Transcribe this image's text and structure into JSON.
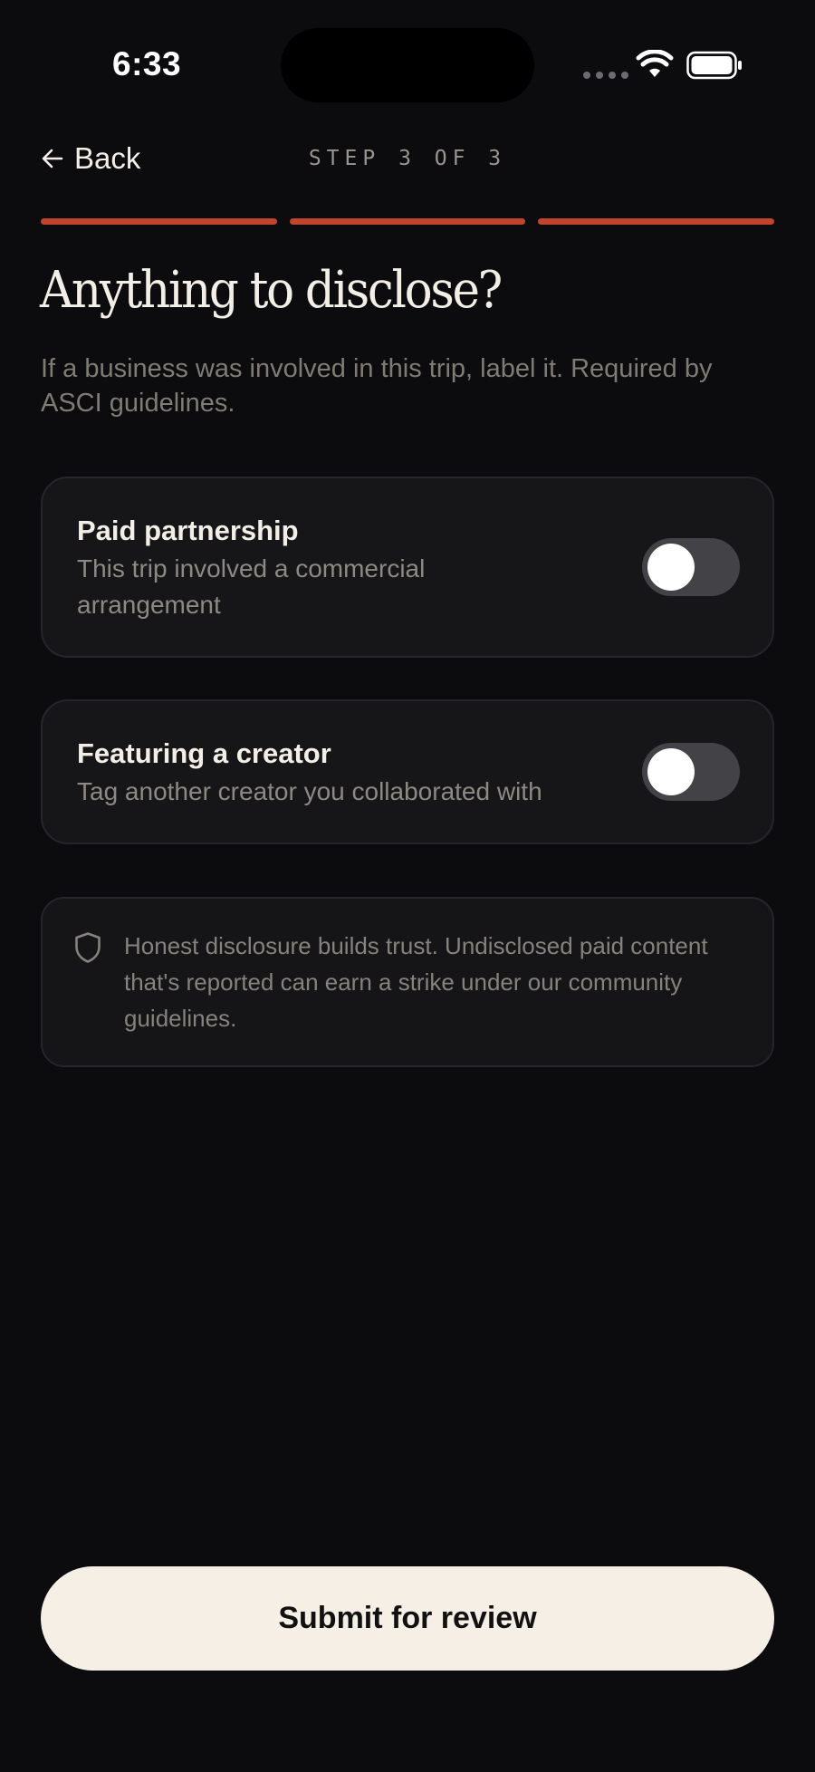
{
  "status_bar": {
    "time": "6:33",
    "icons": [
      "signal-dots-icon",
      "wifi-icon",
      "battery-icon"
    ]
  },
  "header": {
    "back_label": "Back",
    "step_label": "STEP 3 OF 3"
  },
  "progress": {
    "total_steps": 3,
    "current_step": 3
  },
  "main": {
    "title": "Anything to disclose?",
    "subtitle": "If a business was involved in this trip, label it. Required by ASCI guidelines.",
    "options": [
      {
        "title": "Paid partnership",
        "description": "This trip involved a commercial arrangement",
        "enabled": false
      },
      {
        "title": "Featuring a creator",
        "description": "Tag another creator you collaborated with",
        "enabled": false
      }
    ],
    "notice": {
      "icon": "shield-icon",
      "text": "Honest disclosure builds trust. Undisclosed paid content that's reported can earn a strike under our community guidelines."
    }
  },
  "footer": {
    "submit_label": "Submit for review"
  },
  "colors": {
    "background": "#0c0c0e",
    "accent": "#c0452c",
    "button": "#f5efe6"
  }
}
